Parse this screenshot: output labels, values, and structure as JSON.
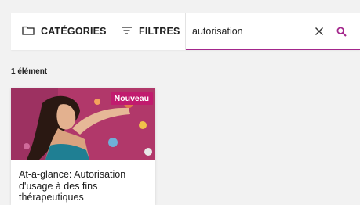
{
  "toolbar": {
    "categories_label": "CATÉGORIES",
    "filters_label": "FILTRES"
  },
  "search": {
    "value": "autorisation",
    "accent_color": "#a3278c"
  },
  "results": {
    "count_label": "1 élément"
  },
  "cards": [
    {
      "badge": "Nouveau",
      "title": "At-a-glance: Autorisation d'usage à des fins thérapeutiques",
      "image_icon": "woman-climbing-photo"
    }
  ],
  "icons": {
    "categories": "folder-icon",
    "filters": "filter-lines-icon",
    "clear": "close-icon",
    "search": "search-icon"
  },
  "colors": {
    "accent": "#a3278c",
    "badge": "#c11b6e",
    "background": "#f2f2f2"
  }
}
